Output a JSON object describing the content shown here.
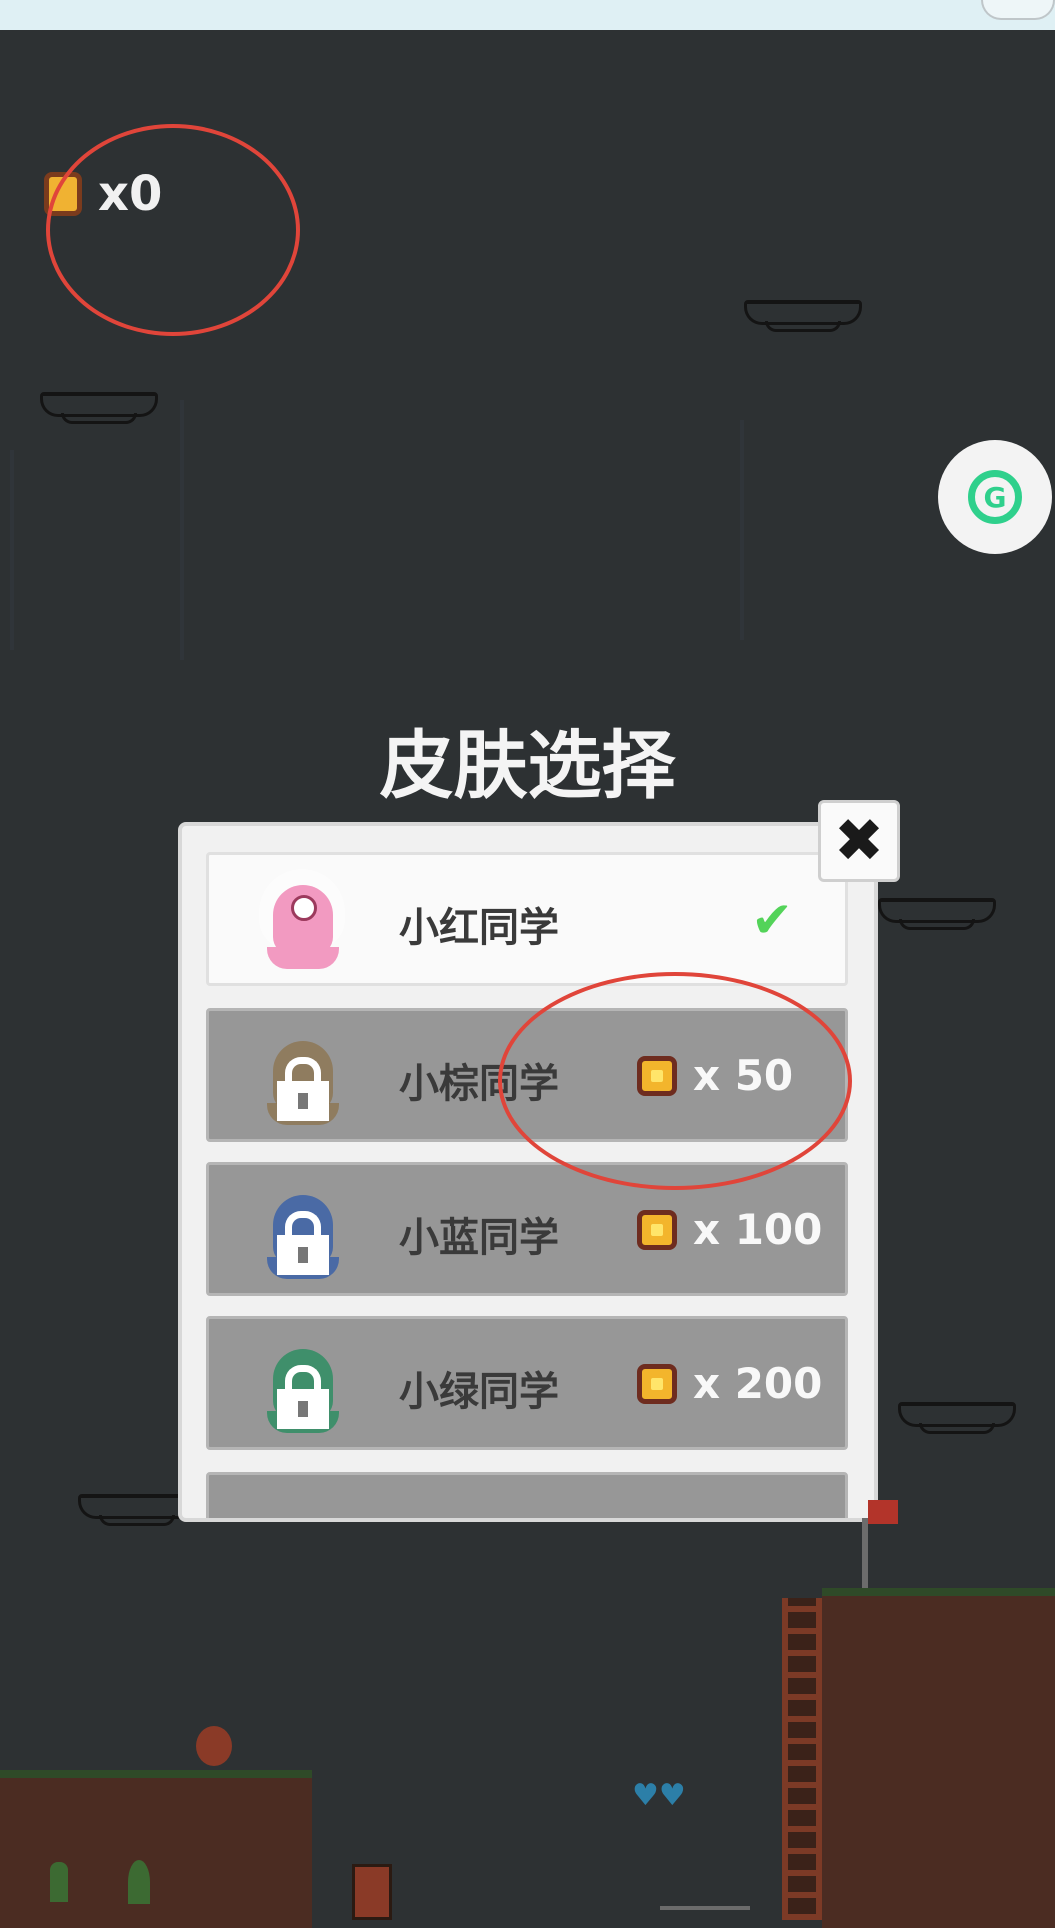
{
  "hud": {
    "coin_icon": "coin-icon",
    "coin_count": "x0"
  },
  "side_button": {
    "icon": "refresh-g-icon",
    "label": "G"
  },
  "dialog": {
    "title": "皮肤选择",
    "close_label": "✖",
    "skins": [
      {
        "name": "小红同学",
        "status": "selected",
        "color": "#f29ac1",
        "check": "✔"
      },
      {
        "name": "小棕同学",
        "status": "locked",
        "color": "#8a6a3a",
        "price": "x 50"
      },
      {
        "name": "小蓝同学",
        "status": "locked",
        "color": "#4a6aa5",
        "price": "x 100"
      },
      {
        "name": "小绿同学",
        "status": "locked",
        "color": "#3f8f6b",
        "price": "x 200"
      }
    ]
  },
  "colors": {
    "background": "#2d3133",
    "annotation": "#e0453a",
    "accent_green": "#53d359"
  }
}
